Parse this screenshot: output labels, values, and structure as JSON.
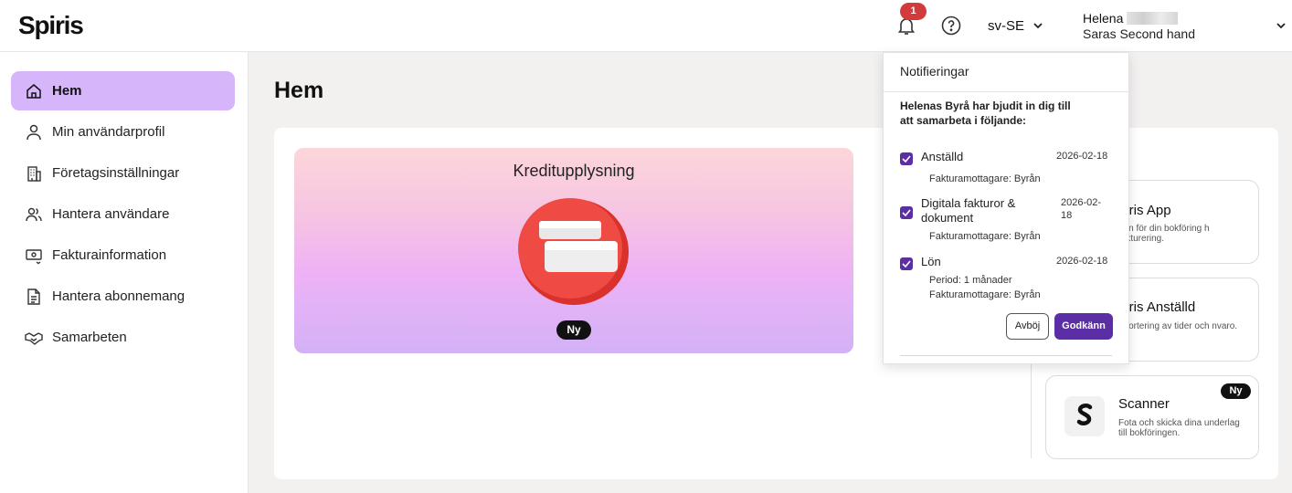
{
  "header": {
    "logo": "Spiris",
    "notification_count": "1",
    "language": "sv-SE",
    "user_name": "Helena",
    "company": "Saras Second hand"
  },
  "sidebar": {
    "items": [
      {
        "label": "Hem",
        "icon": "home-icon"
      },
      {
        "label": "Min användarprofil",
        "icon": "user-icon"
      },
      {
        "label": "Företagsinställningar",
        "icon": "building-icon"
      },
      {
        "label": "Hantera användare",
        "icon": "users-icon"
      },
      {
        "label": "Fakturainformation",
        "icon": "invoice-icon"
      },
      {
        "label": "Hantera abonnemang",
        "icon": "document-icon"
      },
      {
        "label": "Samarbeten",
        "icon": "handshake-icon"
      }
    ]
  },
  "main": {
    "title": "Hem",
    "banner": {
      "title": "Kreditupplysning",
      "badge": "Ny"
    },
    "apps": [
      {
        "title": "piris App",
        "desc": "pen för din bokföring h fakturering."
      },
      {
        "title": "piris Anställd",
        "desc": "pportering av tider och nvaro."
      },
      {
        "title": "Scanner",
        "desc": "Fota och skicka dina underlag till bokföringen.",
        "badge": "Ny"
      }
    ]
  },
  "notifications": {
    "title": "Notifieringar",
    "intro": "Helenas Byrå har bjudit in dig till att samarbeta i följande:",
    "items": [
      {
        "label": "Anställd",
        "date": "2026-02-18",
        "sub1": "Fakturamottagare: Byrån",
        "sub2": ""
      },
      {
        "label": "Digitala fakturor & dokument",
        "date": "2026-02-18",
        "sub1": "Fakturamottagare: Byrån",
        "sub2": ""
      },
      {
        "label": "Lön",
        "date": "2026-02-18",
        "sub1": "Period: 1 månader",
        "sub2": "Fakturamottagare: Byrån"
      }
    ],
    "reject_label": "Avböj",
    "accept_label": "Godkänn"
  },
  "colors": {
    "accent": "#5b2ea6",
    "active_nav": "#d6b5fb",
    "badge_red": "#d23b3b"
  }
}
